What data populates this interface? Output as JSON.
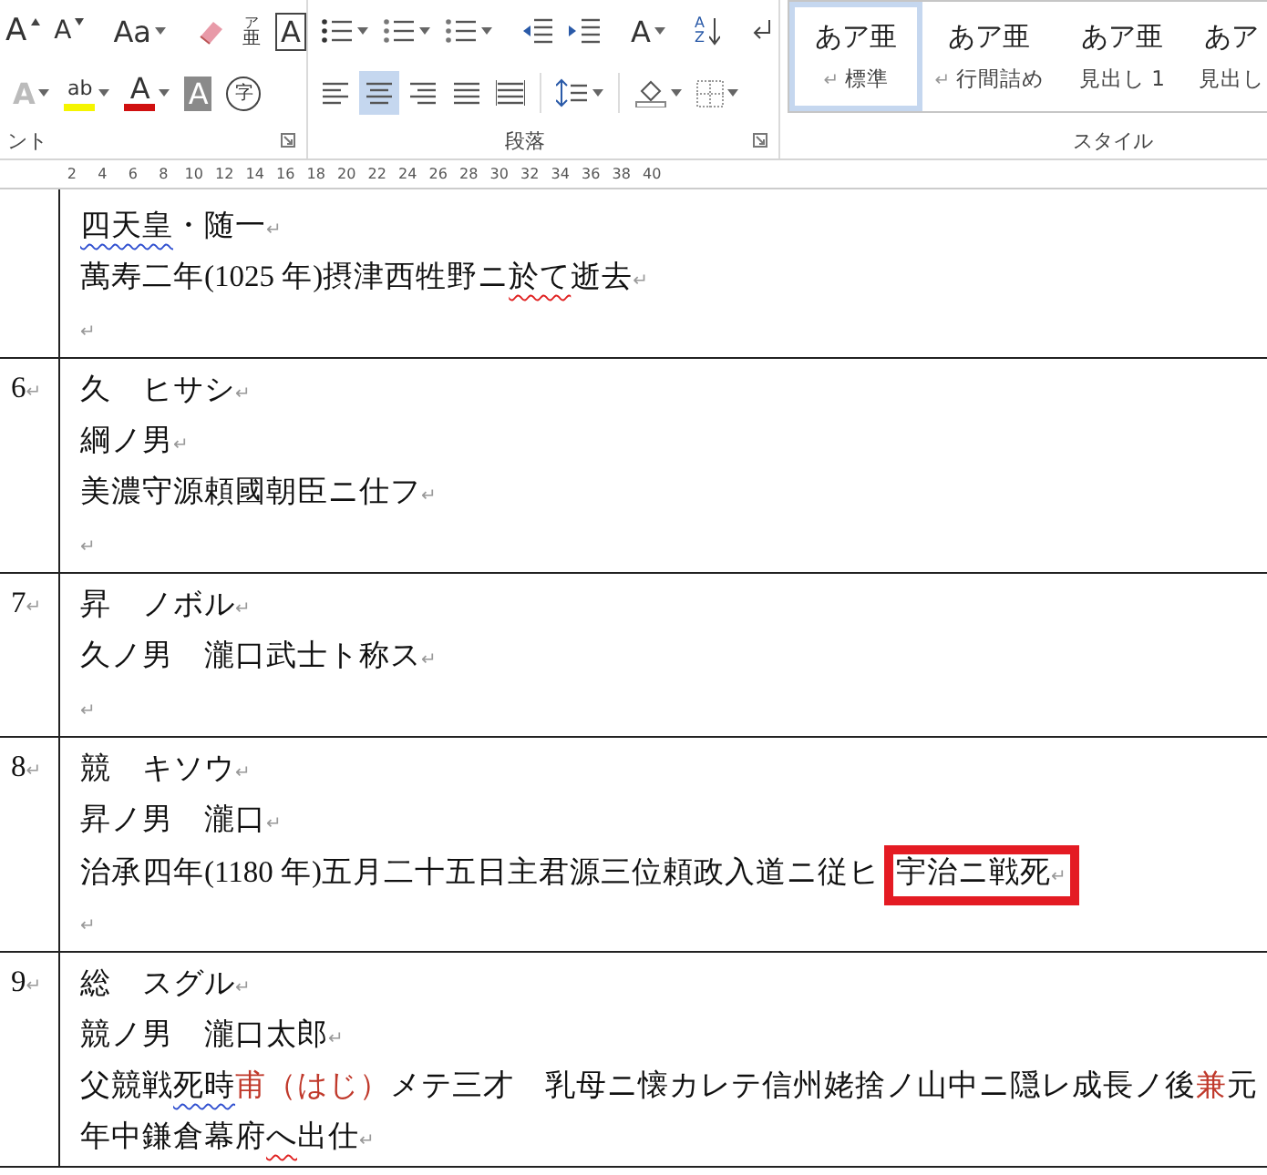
{
  "ribbon": {
    "font_group": {
      "label": "ント",
      "rows": [
        [
          {
            "kind": "grow",
            "glyph": "A"
          },
          {
            "kind": "shrink",
            "glyph": "A"
          },
          {
            "kind": "case",
            "glyph": "Aa",
            "dropdown": true
          },
          {
            "kind": "clear"
          },
          {
            "kind": "ruby",
            "glyph": "亜",
            "ruby": "ア"
          },
          {
            "kind": "boxed",
            "glyph": "A"
          }
        ],
        [
          {
            "kind": "effects",
            "glyph": "A",
            "dropdown": true
          },
          {
            "kind": "highlight",
            "glyph": "ab",
            "dropdown": true,
            "color": "#f5f500"
          },
          {
            "kind": "fontcolor",
            "glyph": "A",
            "dropdown": true,
            "color": "#d01010"
          },
          {
            "kind": "shade",
            "glyph": "A"
          },
          {
            "kind": "enclose",
            "glyph": "字"
          }
        ]
      ]
    },
    "paragraph_group": {
      "label": "段落",
      "rows": [
        [
          {
            "kind": "bullets",
            "dropdown": true
          },
          {
            "kind": "numbering",
            "dropdown": true
          },
          {
            "kind": "multilevel",
            "dropdown": true
          },
          {
            "kind": "outdent"
          },
          {
            "kind": "indent"
          },
          {
            "kind": "asian",
            "glyph": "A",
            "dropdown": true
          },
          {
            "kind": "sort",
            "glyph": "AZ"
          },
          {
            "kind": "marks"
          }
        ],
        [
          {
            "kind": "align_left",
            "selected": false
          },
          {
            "kind": "align_center",
            "selected": true
          },
          {
            "kind": "align_right",
            "selected": false
          },
          {
            "kind": "justify",
            "selected": false
          },
          {
            "kind": "distribute",
            "selected": false
          },
          {
            "kind": "spacing",
            "dropdown": true
          },
          {
            "kind": "fill",
            "dropdown": true
          },
          {
            "kind": "borders",
            "dropdown": true
          }
        ]
      ]
    },
    "styles": {
      "label": "スタイル",
      "items": [
        {
          "sample": "あア亜",
          "name": "標準",
          "mark": "↵",
          "selected": true
        },
        {
          "sample": "あア亜",
          "name": "行間詰め",
          "mark": "↵",
          "selected": false
        },
        {
          "sample": "あア亜",
          "name": "見出し 1",
          "selected": false
        },
        {
          "sample": "あア",
          "name": "見出し",
          "selected": false
        }
      ]
    }
  },
  "ruler": [
    "2",
    "4",
    "6",
    "8",
    "10",
    "12",
    "14",
    "16",
    "18",
    "20",
    "22",
    "24",
    "26",
    "28",
    "30",
    "32",
    "34",
    "36",
    "38",
    "40"
  ],
  "table": {
    "rows": [
      {
        "lines": [
          {
            "segments": [
              {
                "text": "四天皇",
                "grammar_error": true
              },
              {
                "text": "・随一"
              }
            ],
            "mark": "↵"
          },
          {
            "segments": [
              {
                "text": "萬寿二年(1025 年)摂津西牲野ニ"
              },
              {
                "text": "於て",
                "spelling_error": true
              },
              {
                "text": "逝去"
              }
            ],
            "mark": "↵"
          },
          {
            "mark": "↵"
          }
        ]
      },
      {
        "number": "6",
        "mark": "↵",
        "lines": [
          {
            "segments": [
              {
                "text": "久　ヒサシ"
              }
            ],
            "mark": "↵"
          },
          {
            "segments": [
              {
                "text": "綱ノ男"
              }
            ],
            "mark": "↵"
          },
          {
            "segments": [
              {
                "text": "美濃守源頼國朝臣ニ仕フ"
              }
            ],
            "mark": "↵"
          },
          {
            "mark": "↵"
          }
        ]
      },
      {
        "number": "7",
        "mark": "↵",
        "lines": [
          {
            "segments": [
              {
                "text": "昇　ノボル"
              }
            ],
            "mark": "↵"
          },
          {
            "segments": [
              {
                "text": "久ノ男　瀧口武士ト称ス"
              }
            ],
            "mark": "↵"
          },
          {
            "mark": "↵"
          }
        ]
      },
      {
        "number": "8",
        "mark": "↵",
        "lines": [
          {
            "segments": [
              {
                "text": "競　キソウ"
              }
            ],
            "mark": "↵"
          },
          {
            "segments": [
              {
                "text": "昇ノ男　瀧口"
              }
            ],
            "mark": "↵"
          },
          {
            "segments": [
              {
                "text": "治承四年(1180 年)五月二十五日主君源三位頼政入道ニ従ヒ"
              },
              {
                "text": "宇治ニ戦死",
                "boxed": true,
                "mark": "↵"
              }
            ]
          },
          {
            "mark": "↵"
          }
        ]
      },
      {
        "number": "9",
        "mark": "↵",
        "lines": [
          {
            "segments": [
              {
                "text": "総　スグル"
              }
            ],
            "mark": "↵"
          },
          {
            "segments": [
              {
                "text": "競ノ男　瀧口太郎"
              }
            ],
            "mark": "↵"
          },
          {
            "segments": [
              {
                "text": "父競戦"
              },
              {
                "text": "死時",
                "grammar_error": true
              },
              {
                "text": "甫（はじ）",
                "color": "#c0392b"
              },
              {
                "text": "メテ三才　乳母ニ懐カレテ信州姥捨ノ山中ニ隠レ成長ノ後"
              },
              {
                "text": "兼",
                "color": "#c0392b"
              },
              {
                "text": "元"
              }
            ]
          },
          {
            "segments": [
              {
                "text": "年中鎌倉幕府"
              },
              {
                "text": "へ",
                "spelling_error": true
              },
              {
                "text": "出仕"
              }
            ],
            "mark": "↵"
          }
        ]
      }
    ]
  }
}
